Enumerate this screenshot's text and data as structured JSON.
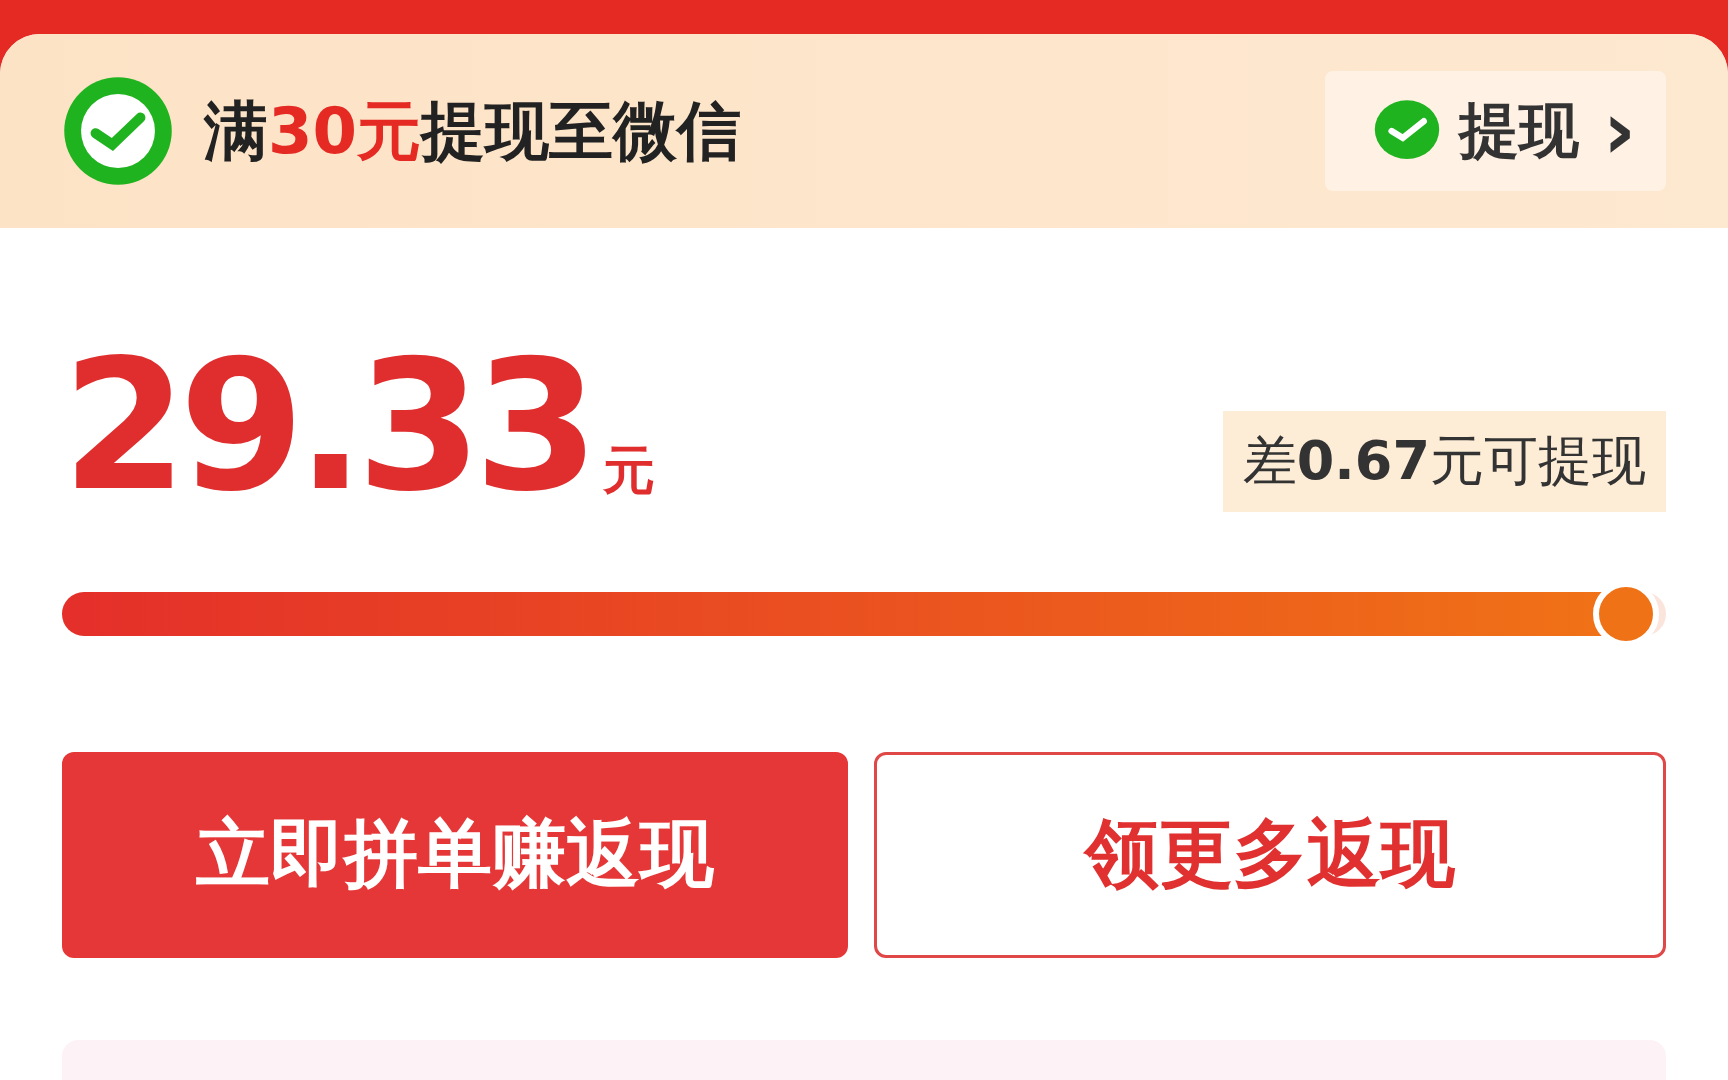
{
  "header": {
    "before": "满",
    "amount": "30元",
    "after": "提现至微信"
  },
  "withdraw_button": {
    "label": "提现",
    "arrow": "›"
  },
  "balance": {
    "amount": "29.33",
    "unit": "元"
  },
  "remaining": "差**0.67**元可提现",
  "progress": {
    "level": 0.975
  },
  "buttons": [
    {
      "label": "立即拼单赚返现",
      "kind": "primary"
    },
    {
      "label": "领更多返现",
      "kind": "outline"
    }
  ]
}
